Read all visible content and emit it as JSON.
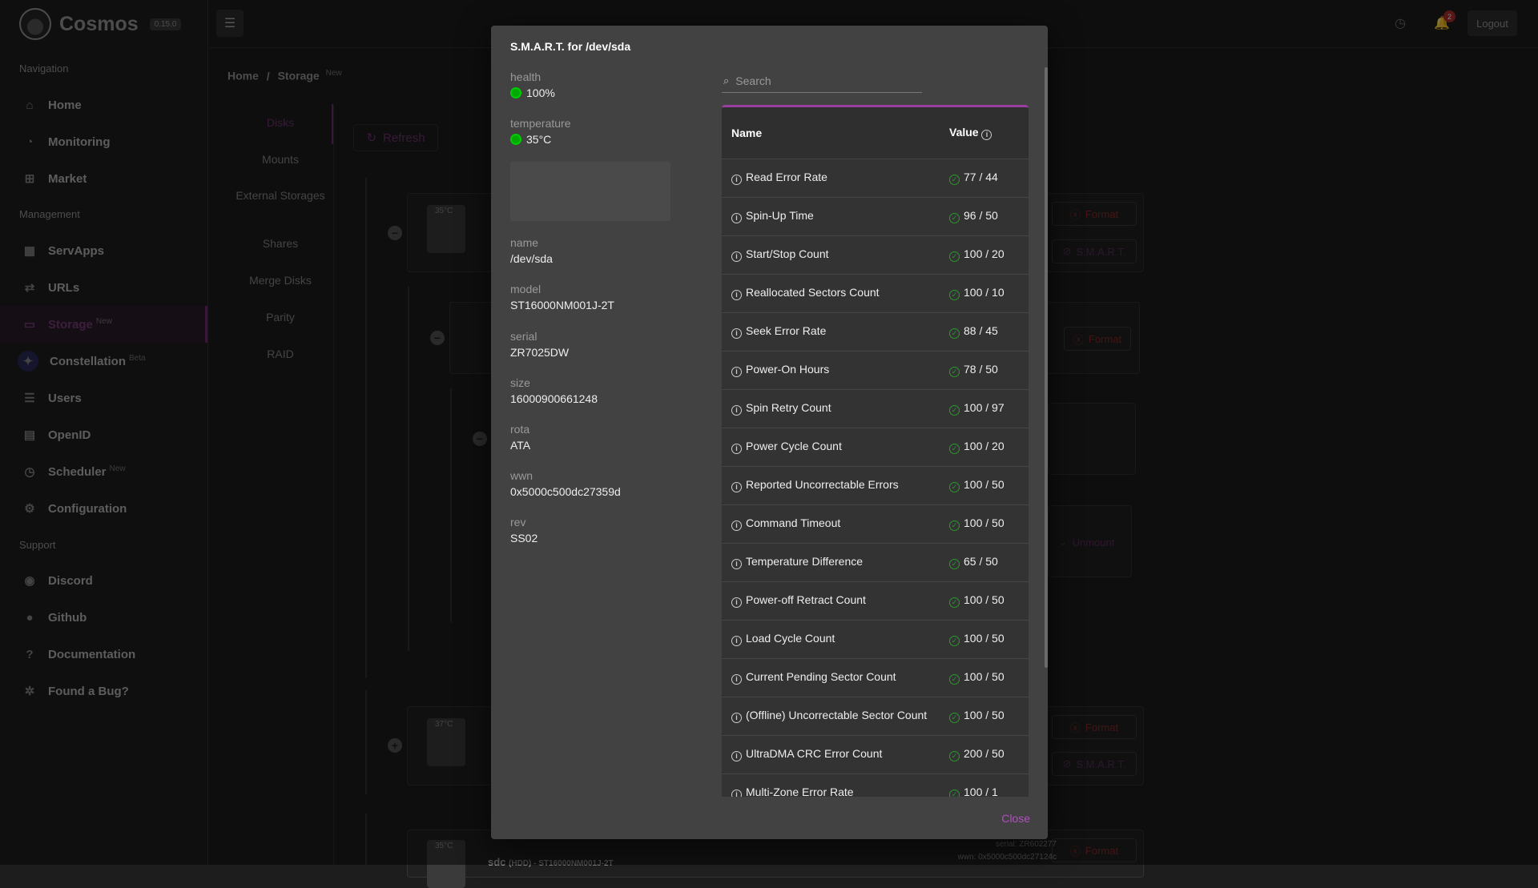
{
  "app": {
    "name": "Cosmos",
    "version": "0.15.0"
  },
  "sidebar": {
    "sections": {
      "navigation": "Navigation",
      "management": "Management",
      "support": "Support"
    },
    "items": [
      {
        "label": "Home",
        "icon": "home-icon"
      },
      {
        "label": "Monitoring",
        "icon": "dashboard-icon"
      },
      {
        "label": "Market",
        "icon": "apps-icon"
      },
      {
        "label": "ServApps",
        "icon": "grid-icon"
      },
      {
        "label": "URLs",
        "icon": "swap-icon"
      },
      {
        "label": "Storage",
        "icon": "folder-icon",
        "tag": "New",
        "active": true
      },
      {
        "label": "Constellation",
        "icon": "constellation-icon",
        "tag": "Beta"
      },
      {
        "label": "Users",
        "icon": "user-list-icon"
      },
      {
        "label": "OpenID",
        "icon": "id-card-icon"
      },
      {
        "label": "Scheduler",
        "icon": "clock-icon",
        "tag": "New"
      },
      {
        "label": "Configuration",
        "icon": "gear-icon"
      },
      {
        "label": "Discord",
        "icon": "discord-icon"
      },
      {
        "label": "Github",
        "icon": "github-icon"
      },
      {
        "label": "Documentation",
        "icon": "question-icon"
      },
      {
        "label": "Found a Bug?",
        "icon": "bug-icon"
      }
    ]
  },
  "topbar": {
    "logout": "Logout",
    "notifications": "2"
  },
  "breadcrumb": {
    "home": "Home",
    "sep": "/",
    "current": "Storage",
    "tag": "New"
  },
  "subnav": [
    "Disks",
    "Mounts",
    "External Storages",
    "Shares",
    "Merge Disks",
    "Parity",
    "RAID"
  ],
  "main": {
    "refresh": "Refresh",
    "format": "Format",
    "smart": "S.M.A.R.T.",
    "unmount": "Unmount",
    "disk1_temp": "35°C",
    "disk2_temp": "37°C",
    "disk3_temp": "35°C",
    "disk3_name": "sdc",
    "disk3_meta": "(HDD) - ST16000NM001J-2T",
    "disk3_serial": "serial: ZR602277",
    "disk3_wwn": "wwn: 0x5000c500dc27124c"
  },
  "modal": {
    "title": "S.M.A.R.T. for /dev/sda",
    "health_label": "health",
    "health_value": "100%",
    "temperature_label": "temperature",
    "temperature_value": "35°C",
    "fields": [
      {
        "label": "name",
        "value": "/dev/sda"
      },
      {
        "label": "model",
        "value": "ST16000NM001J-2T"
      },
      {
        "label": "serial",
        "value": "ZR7025DW"
      },
      {
        "label": "size",
        "value": "16000900661248"
      },
      {
        "label": "rota",
        "value": "ATA"
      },
      {
        "label": "wwn",
        "value": "0x5000c500dc27359d"
      },
      {
        "label": "rev",
        "value": "SS02"
      }
    ],
    "search_placeholder": "Search",
    "columns": {
      "name": "Name",
      "value": "Value"
    },
    "rows": [
      {
        "name": "Read Error Rate",
        "value": "77 / 44"
      },
      {
        "name": "Spin-Up Time",
        "value": "96 / 50"
      },
      {
        "name": "Start/Stop Count",
        "value": "100 / 20"
      },
      {
        "name": "Reallocated Sectors Count",
        "value": "100 / 10"
      },
      {
        "name": "Seek Error Rate",
        "value": "88 / 45"
      },
      {
        "name": "Power-On Hours",
        "value": "78 / 50"
      },
      {
        "name": "Spin Retry Count",
        "value": "100 / 97"
      },
      {
        "name": "Power Cycle Count",
        "value": "100 / 20"
      },
      {
        "name": "Reported Uncorrectable Errors",
        "value": "100 / 50"
      },
      {
        "name": "Command Timeout",
        "value": "100 / 50"
      },
      {
        "name": "Temperature Difference",
        "value": "65 / 50"
      },
      {
        "name": "Power-off Retract Count",
        "value": "100 / 50"
      },
      {
        "name": "Load Cycle Count",
        "value": "100 / 50"
      },
      {
        "name": "Current Pending Sector Count",
        "value": "100 / 50"
      },
      {
        "name": "(Offline) Uncorrectable Sector Count",
        "value": "100 / 50"
      },
      {
        "name": "UltraDMA CRC Error Count",
        "value": "200 / 50"
      },
      {
        "name": "Multi-Zone Error Rate",
        "value": "100 / 1"
      }
    ],
    "close": "Close"
  }
}
